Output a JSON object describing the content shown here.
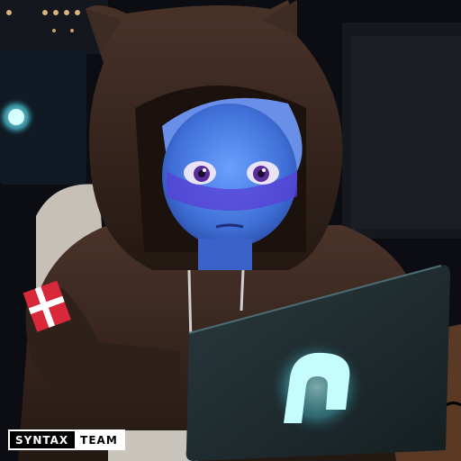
{
  "watermark": {
    "word_dark": "SYNTAX",
    "word_light": "TEAM"
  },
  "scene": {
    "subject": "hooded-figure-with-laptop",
    "colors": {
      "background": "#0b0d12",
      "hoodie": "#3a2a22",
      "skin": "#4a7fe0",
      "screen_glow": "#7ff3ff",
      "laptop": "#1d2a2e"
    }
  }
}
